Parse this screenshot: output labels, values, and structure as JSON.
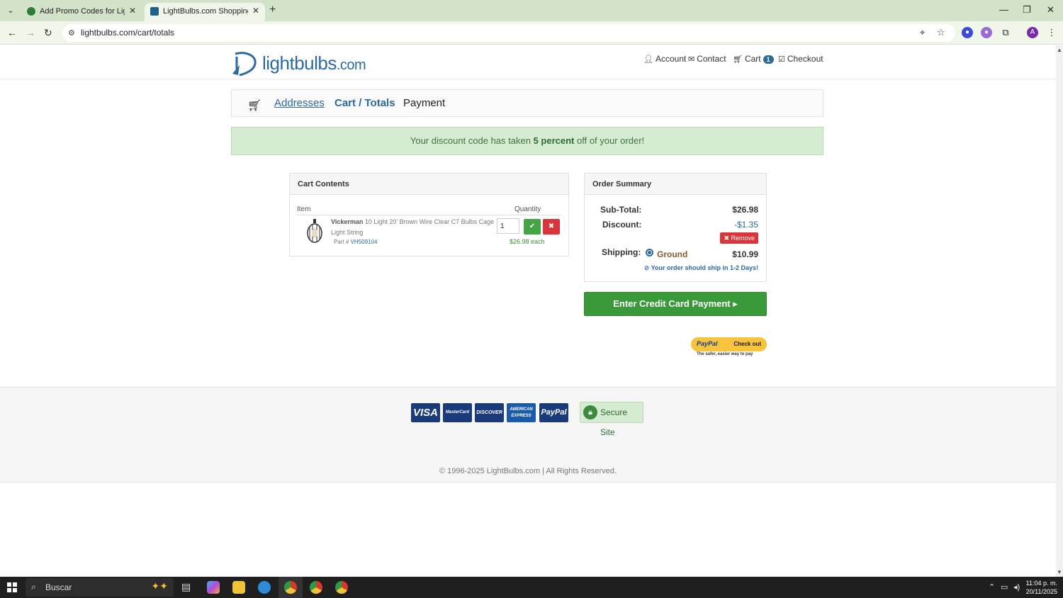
{
  "browser": {
    "tabs": [
      {
        "title": "Add Promo Codes for Lightbulbs",
        "active": false
      },
      {
        "title": "LightBulbs.com Shopping Cart",
        "active": true
      }
    ],
    "url": "lightbulbs.com/cart/totals",
    "profile_initial": "A"
  },
  "header": {
    "logo_text": "lightbulbs",
    "logo_suffix": ".com",
    "nav": {
      "account": "Account",
      "contact": "Contact",
      "cart": "Cart",
      "cart_count": "1",
      "checkout": "Checkout"
    }
  },
  "steps": {
    "addresses": "Addresses",
    "cart_totals": "Cart / Totals",
    "payment": "Payment"
  },
  "alert": {
    "prefix": "Your discount code has taken ",
    "highlight": "5 percent",
    "suffix": " off of your order!"
  },
  "cart": {
    "title": "Cart Contents",
    "col_item": "Item",
    "col_quantity": "Quantity",
    "item": {
      "brand": "Vickerman",
      "name": " 10 Light 20' Brown Wire Clear C7 Bulbs Cage Light String",
      "part_label": "Part # ",
      "part_number": "VH509104",
      "quantity": "1",
      "price_each": "$26.98 each"
    }
  },
  "summary": {
    "title": "Order Summary",
    "subtotal_label": "Sub-Total:",
    "subtotal_value": "$26.98",
    "discount_label": "Discount:",
    "discount_value": "-$1.35",
    "remove_label": "Remove",
    "shipping_label": "Shipping:",
    "shipping_method": "Ground",
    "shipping_value": "$10.99",
    "ship_note": "Your order should ship in 1-2 Days!"
  },
  "actions": {
    "credit_card": "Enter Credit Card Payment",
    "paypal_brand": "PayPal",
    "paypal_checkout": "Check out",
    "paypal_tagline": "The safer, easier way to pay"
  },
  "footer": {
    "cards": [
      "VISA",
      "MasterCard",
      "DISCOVER",
      "AMERICAN EXPRESS",
      "PayPal"
    ],
    "secure": "Secure Site",
    "copyright": "© 1996-2025 LightBulbs.com | All Rights Reserved."
  },
  "taskbar": {
    "search_placeholder": "Buscar",
    "time": "11:04 p. m.",
    "date": "20/11/2025"
  },
  "colors": {
    "brand_blue": "#2b6aa0",
    "success_green": "#3a9a3a",
    "danger_red": "#d9353a",
    "alert_bg": "#d6ecd2"
  }
}
